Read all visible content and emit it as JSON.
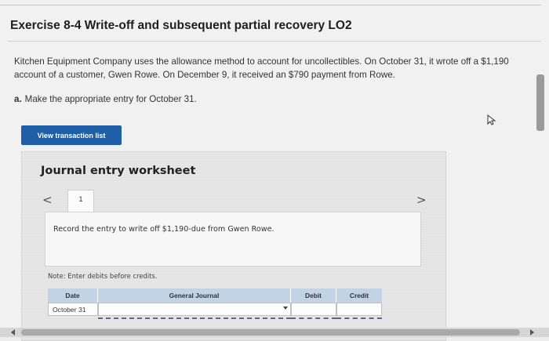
{
  "exercise": {
    "title": "Exercise 8-4 Write-off and subsequent partial recovery LO2",
    "description": "Kitchen Equipment Company uses the allowance method to account for uncollectibles. On October 31, it wrote off a $1,190 account of a customer, Gwen Rowe. On December 9, it received an $790 payment from Rowe.",
    "part_letter": "a.",
    "part_text": "Make the appropriate entry for October 31."
  },
  "buttons": {
    "view_transactions": "View transaction list"
  },
  "worksheet": {
    "title": "Journal entry worksheet",
    "prev": "<",
    "next": ">",
    "tab_number": "1",
    "prompt": "Record the entry to write off $1,190-due from Gwen Rowe.",
    "note": "Note: Enter debits before credits."
  },
  "table": {
    "headers": {
      "date": "Date",
      "general_journal": "General Journal",
      "debit": "Debit",
      "credit": "Credit"
    },
    "rows": [
      {
        "date": "October 31",
        "account": "",
        "debit": "",
        "credit": ""
      }
    ]
  },
  "colors": {
    "button_bg": "#1f5fa8",
    "table_header_bg": "#c3d3e6"
  }
}
